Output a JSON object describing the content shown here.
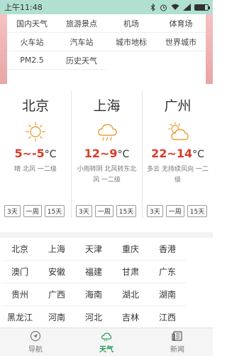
{
  "status_bar": {
    "time": "上午11:48"
  },
  "categories": [
    {
      "label": "国内天气"
    },
    {
      "label": "旅游景点"
    },
    {
      "label": "机场"
    },
    {
      "label": "体育场"
    },
    {
      "label": "火车站"
    },
    {
      "label": "汽车站"
    },
    {
      "label": "城市地标"
    },
    {
      "label": "世界城市"
    },
    {
      "label": "PM2.5"
    },
    {
      "label": "历史天气"
    }
  ],
  "cities": [
    {
      "name": "北京",
      "icon": "sunny-icon",
      "temp": "5~-5",
      "unit": "°C",
      "desc": "晴 北风 一二级",
      "ranges": [
        "3天",
        "一周",
        "15天"
      ]
    },
    {
      "name": "上海",
      "icon": "rain-icon",
      "temp": "12~9",
      "unit": "°C",
      "desc": "小雨转阴 北风转东北风 一二级",
      "ranges": [
        "3天",
        "一周",
        "15天"
      ]
    },
    {
      "name": "广州",
      "icon": "partly-cloudy-icon",
      "temp": "22~14",
      "unit": "°C",
      "desc": "多云 无持续风向 一二级",
      "ranges": [
        "3天",
        "一周",
        "15天"
      ]
    }
  ],
  "provinces": [
    "北京",
    "上海",
    "天津",
    "重庆",
    "香港",
    "澳门",
    "安徽",
    "福建",
    "甘肃",
    "广东",
    "贵州",
    "广西",
    "海南",
    "湖北",
    "湖南",
    "黑龙江",
    "河南",
    "河北",
    "吉林",
    "江西"
  ],
  "bottom_nav": {
    "items": [
      {
        "label": "导航",
        "icon": "navigation-icon",
        "active": false
      },
      {
        "label": "天气",
        "icon": "weather-icon",
        "active": true
      },
      {
        "label": "新闻",
        "icon": "news-icon",
        "active": false
      }
    ]
  },
  "colors": {
    "accent": "#2a9d5c",
    "temp_red": "#d93a2a",
    "status_bar": "#b0e0d0"
  }
}
